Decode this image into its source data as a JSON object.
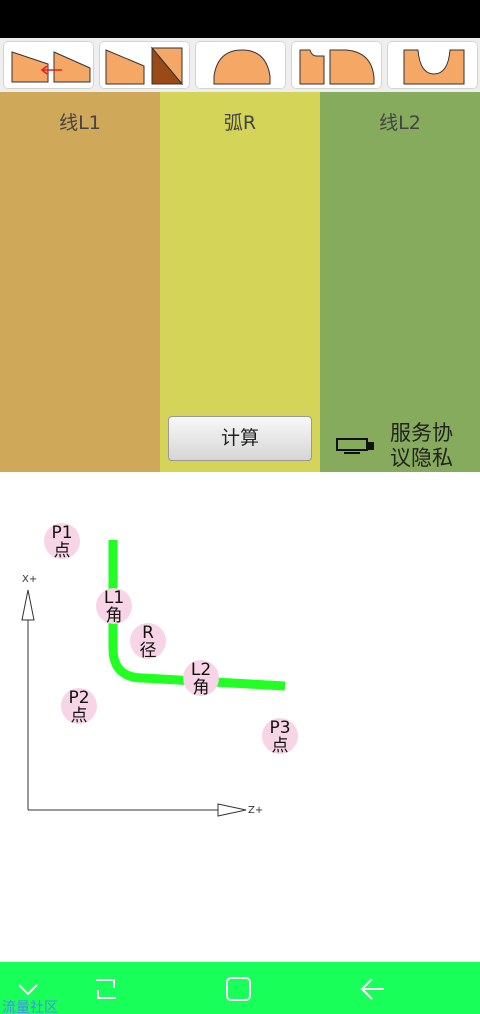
{
  "toolbar": {
    "icons": [
      "bevel-arrow-icon",
      "chamfer-icon",
      "round-arch-icon",
      "step-round-icon",
      "concave-groove-icon"
    ]
  },
  "panels": [
    {
      "label": "线L1",
      "color": "#d0a85a"
    },
    {
      "label": "弧R",
      "color": "#d3d458"
    },
    {
      "label": "线L2",
      "color": "#86ab5d"
    }
  ],
  "calc_button": {
    "label": "计算"
  },
  "privacy": {
    "label": "服务协议隐私政策"
  },
  "diagram": {
    "axis_x_label": "X+",
    "axis_z_label": "Z+",
    "markers": [
      {
        "top": "P1",
        "bottom": "点"
      },
      {
        "top": "L1",
        "bottom": "角"
      },
      {
        "top": "R",
        "bottom": "径"
      },
      {
        "top": "L2",
        "bottom": "角"
      },
      {
        "top": "P2",
        "bottom": "点"
      },
      {
        "top": "P3",
        "bottom": "点"
      }
    ],
    "path_color": "#22ff22",
    "marker_color": "#f7d4e6"
  },
  "watermark": "流量社区",
  "nav": {
    "color": "#18ff5a"
  }
}
